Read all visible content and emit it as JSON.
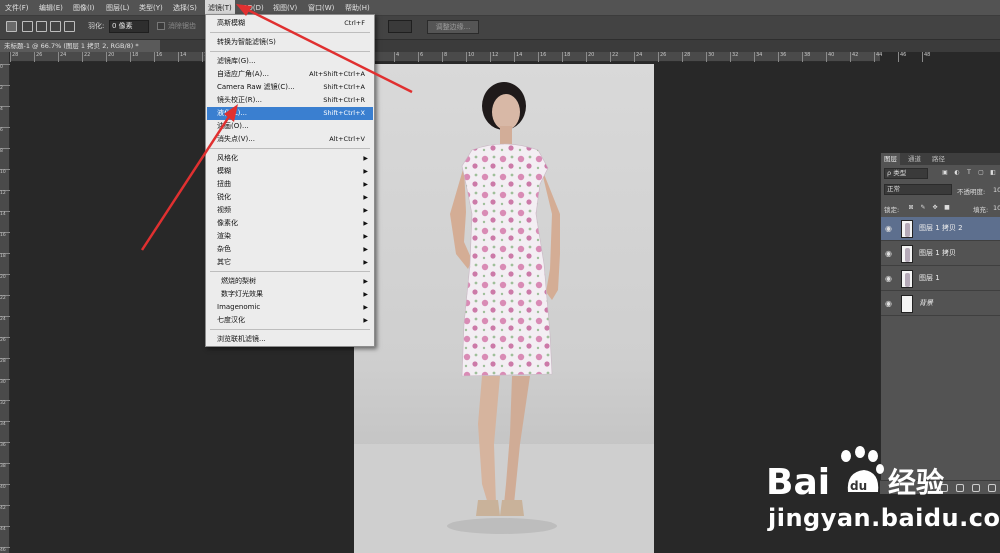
{
  "menubar": {
    "items": [
      "文件(F)",
      "编辑(E)",
      "图像(I)",
      "图层(L)",
      "类型(Y)",
      "选择(S)",
      "滤镜(T)",
      "3D(D)",
      "视图(V)",
      "窗口(W)",
      "帮助(H)"
    ],
    "active": "滤镜(T)"
  },
  "options": {
    "feather_label": "羽化:",
    "feather_value": "0 像素",
    "antialias_label": "消除锯齿",
    "refine_label": "调整边缘..."
  },
  "document_tab": "未标题-1 @ 66.7% (图层 1 拷贝 2, RGB/8) *",
  "ruler_top_ticks": [
    "28",
    "26",
    "24",
    "22",
    "20",
    "18",
    "16",
    "14",
    "12",
    "10",
    "8",
    "6",
    "4",
    "2",
    "0",
    "2",
    "4",
    "6",
    "8",
    "10",
    "12",
    "14",
    "16",
    "18",
    "20",
    "22",
    "24",
    "26",
    "28",
    "30",
    "32",
    "34",
    "36",
    "38",
    "40",
    "42",
    "44",
    "46",
    "48"
  ],
  "ruler_left_ticks": [
    "0",
    "2",
    "4",
    "6",
    "8",
    "10",
    "12",
    "14",
    "16",
    "18",
    "20",
    "22",
    "24",
    "26",
    "28",
    "30",
    "32",
    "34",
    "36",
    "38",
    "40",
    "42",
    "44",
    "46"
  ],
  "filter_menu": {
    "items": [
      {
        "label": "高斯模糊",
        "shortcut": "Ctrl+F"
      },
      {
        "label": "转换为智能滤镜(S)",
        "shortcut": ""
      },
      {
        "label": "滤镜库(G)...",
        "shortcut": ""
      },
      {
        "label": "自适应广角(A)...",
        "shortcut": "Alt+Shift+Ctrl+A"
      },
      {
        "label": "Camera Raw 滤镜(C)...",
        "shortcut": "Shift+Ctrl+A"
      },
      {
        "label": "镜头校正(R)...",
        "shortcut": "Shift+Ctrl+R"
      },
      {
        "label": "液化(L)...",
        "shortcut": "Shift+Ctrl+X"
      },
      {
        "label": "油画(O)...",
        "shortcut": ""
      },
      {
        "label": "消失点(V)...",
        "shortcut": "Alt+Ctrl+V"
      },
      {
        "label": "风格化",
        "shortcut": ""
      },
      {
        "label": "模糊",
        "shortcut": ""
      },
      {
        "label": "扭曲",
        "shortcut": ""
      },
      {
        "label": "锐化",
        "shortcut": ""
      },
      {
        "label": "视频",
        "shortcut": ""
      },
      {
        "label": "像素化",
        "shortcut": ""
      },
      {
        "label": "渲染",
        "shortcut": ""
      },
      {
        "label": "杂色",
        "shortcut": ""
      },
      {
        "label": "其它",
        "shortcut": ""
      },
      {
        "label": "燃烧的梨树",
        "shortcut": ""
      },
      {
        "label": "数字灯光效果",
        "shortcut": ""
      },
      {
        "label": "Imagenomic",
        "shortcut": ""
      },
      {
        "label": "七度汉化",
        "shortcut": ""
      },
      {
        "label": "浏览联机滤镜...",
        "shortcut": ""
      }
    ],
    "highlighted": "液化(L)..."
  },
  "layers_panel": {
    "tabs": [
      "图层",
      "通道",
      "路径"
    ],
    "kind_label": "ρ 类型",
    "blend_mode": "正常",
    "opacity_label": "不透明度:",
    "opacity_value": "10",
    "lock_label": "锁定:",
    "fill_label": "填充:",
    "fill_value": "10",
    "layers": [
      {
        "name": "图层 1 拷贝 2",
        "selected": true
      },
      {
        "name": "图层 1 拷贝",
        "selected": false
      },
      {
        "name": "图层 1",
        "selected": false
      },
      {
        "name": "背景",
        "selected": false
      }
    ]
  },
  "watermark": {
    "brand": "Bai",
    "brand_cn": "经验",
    "url": "jingyan.baidu.com"
  },
  "colors": {
    "menu_highlight": "#3a7fd0",
    "arrow": "#e03030",
    "layer_selected": "#5d6f8e"
  }
}
